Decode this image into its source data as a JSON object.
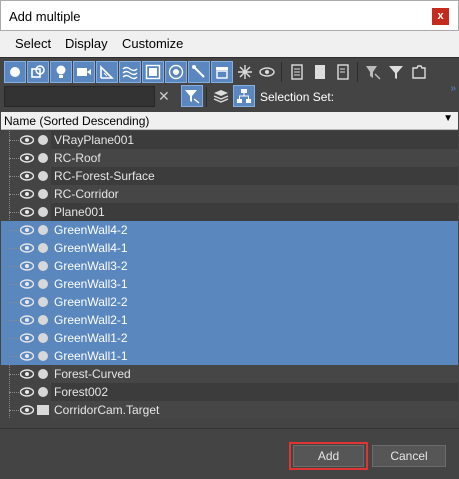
{
  "window": {
    "title": "Add multiple",
    "close_glyph": "x"
  },
  "menu": [
    "Select",
    "Display",
    "Customize"
  ],
  "toolbar": {
    "display_icons": [
      "geometry-icon",
      "shapes-icon",
      "lights-icon",
      "cameras-icon",
      "helpers-icon",
      "space-warps-icon",
      "groups-icon",
      "xrefs-icon",
      "bones-icon",
      "containers-icon",
      "frozen-icon",
      "hidden-icon"
    ],
    "list_icons": [
      "display-all-icon",
      "display-none-icon",
      "invert-display-icon",
      "filter-icon",
      "funnel-icon",
      "folder-icon"
    ]
  },
  "filter": {
    "search_value": "",
    "clear_glyph": "✕",
    "selection_set_label": "Selection Set:",
    "more_glyph": "»"
  },
  "columns": {
    "name_header": "Name (Sorted Descending)",
    "sort_glyph": "▼"
  },
  "items": [
    {
      "name": "VRayPlane001",
      "selected": false,
      "kind": "object"
    },
    {
      "name": "RC-Roof",
      "selected": false,
      "kind": "object"
    },
    {
      "name": "RC-Forest-Surface",
      "selected": false,
      "kind": "object"
    },
    {
      "name": "RC-Corridor",
      "selected": false,
      "kind": "object"
    },
    {
      "name": "Plane001",
      "selected": false,
      "kind": "object"
    },
    {
      "name": "GreenWall4-2",
      "selected": true,
      "kind": "object"
    },
    {
      "name": "GreenWall4-1",
      "selected": true,
      "kind": "object"
    },
    {
      "name": "GreenWall3-2",
      "selected": true,
      "kind": "object"
    },
    {
      "name": "GreenWall3-1",
      "selected": true,
      "kind": "object"
    },
    {
      "name": "GreenWall2-2",
      "selected": true,
      "kind": "object"
    },
    {
      "name": "GreenWall2-1",
      "selected": true,
      "kind": "object"
    },
    {
      "name": "GreenWall1-2",
      "selected": true,
      "kind": "object"
    },
    {
      "name": "GreenWall1-1",
      "selected": true,
      "kind": "object"
    },
    {
      "name": "Forest-Curved",
      "selected": false,
      "kind": "object"
    },
    {
      "name": "Forest002",
      "selected": false,
      "kind": "object"
    },
    {
      "name": "CorridorCam.Target",
      "selected": false,
      "kind": "camera-target"
    }
  ],
  "buttons": {
    "add": "Add",
    "cancel": "Cancel"
  },
  "colors": {
    "selection": "#5b87bf",
    "panel": "#444444",
    "highlight_border": "#e03333"
  }
}
